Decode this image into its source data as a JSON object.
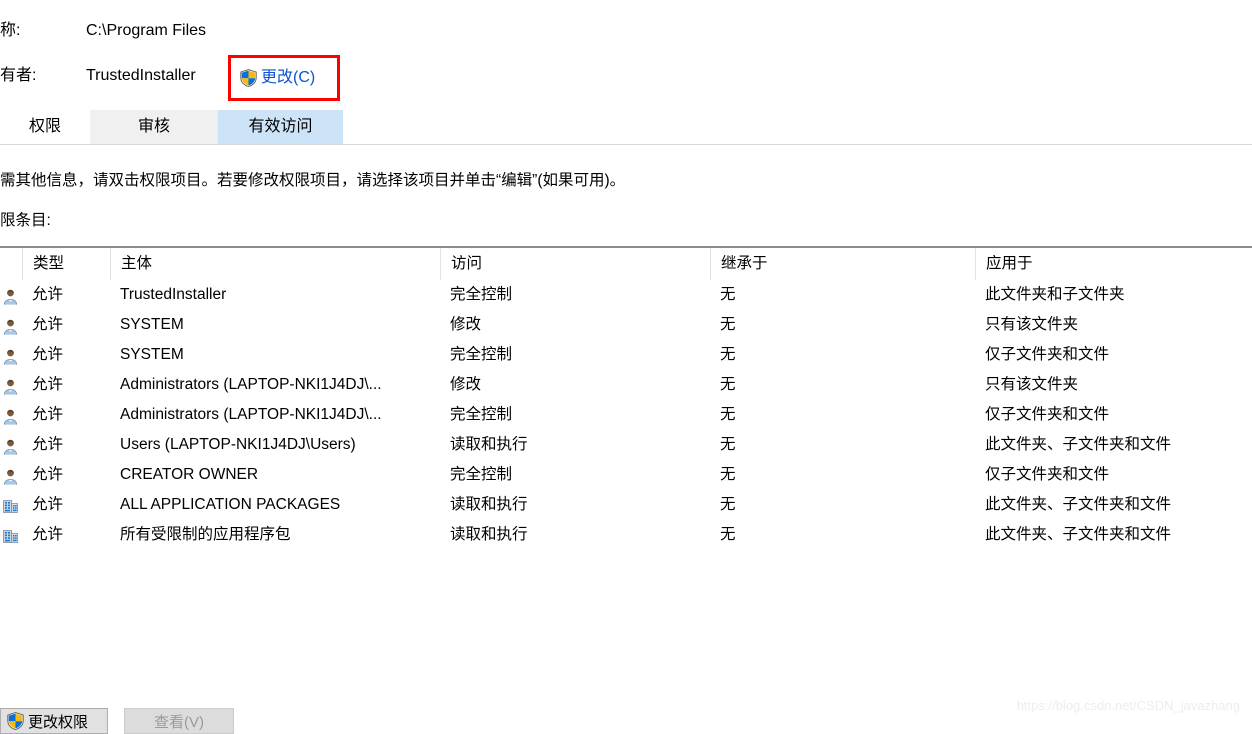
{
  "header": {
    "name_label": "称:",
    "name_value": "C:\\Program Files",
    "owner_label": "有者:",
    "owner_value": "TrustedInstaller",
    "change_owner_label": "更改(C)",
    "change_owner_icon": "uac-shield-icon",
    "highlight_color": "#fe0000",
    "link_color": "#0f52d2"
  },
  "tabs": [
    {
      "label": "权限",
      "state": "active"
    },
    {
      "label": "审核",
      "state": "inactive"
    },
    {
      "label": "有效访问",
      "state": "hover"
    }
  ],
  "description": "需其他信息，请双击权限项目。若要修改权限项目，请选择该项目并单击“编辑”(如果可用)。",
  "entries_label": "限条目:",
  "table": {
    "columns": [
      "类型",
      "主体",
      "访问",
      "继承于",
      "应用于"
    ],
    "rows": [
      {
        "icon": "user-icon",
        "type": "允许",
        "principal": "TrustedInstaller",
        "access": "完全控制",
        "inherited_from": "无",
        "applies_to": "此文件夹和子文件夹"
      },
      {
        "icon": "user-icon",
        "type": "允许",
        "principal": "SYSTEM",
        "access": "修改",
        "inherited_from": "无",
        "applies_to": "只有该文件夹"
      },
      {
        "icon": "user-icon",
        "type": "允许",
        "principal": "SYSTEM",
        "access": "完全控制",
        "inherited_from": "无",
        "applies_to": "仅子文件夹和文件"
      },
      {
        "icon": "user-icon",
        "type": "允许",
        "principal": "Administrators (LAPTOP-NKI1J4DJ\\...",
        "access": "修改",
        "inherited_from": "无",
        "applies_to": "只有该文件夹"
      },
      {
        "icon": "user-icon",
        "type": "允许",
        "principal": "Administrators (LAPTOP-NKI1J4DJ\\...",
        "access": "完全控制",
        "inherited_from": "无",
        "applies_to": "仅子文件夹和文件"
      },
      {
        "icon": "user-icon",
        "type": "允许",
        "principal": "Users (LAPTOP-NKI1J4DJ\\Users)",
        "access": "读取和执行",
        "inherited_from": "无",
        "applies_to": "此文件夹、子文件夹和文件"
      },
      {
        "icon": "user-icon",
        "type": "允许",
        "principal": "CREATOR OWNER",
        "access": "完全控制",
        "inherited_from": "无",
        "applies_to": "仅子文件夹和文件"
      },
      {
        "icon": "app-package-icon",
        "type": "允许",
        "principal": "ALL APPLICATION PACKAGES",
        "access": "读取和执行",
        "inherited_from": "无",
        "applies_to": "此文件夹、子文件夹和文件"
      },
      {
        "icon": "app-package-icon",
        "type": "允许",
        "principal": "所有受限制的应用程序包",
        "access": "读取和执行",
        "inherited_from": "无",
        "applies_to": "此文件夹、子文件夹和文件"
      }
    ]
  },
  "footer": {
    "change_permissions_label": "更改权限",
    "change_permissions_icon": "uac-shield-icon",
    "view_label": "查看(V)",
    "view_disabled": true
  },
  "watermark": "https://blog.csdn.net/CSDN_javazhang"
}
